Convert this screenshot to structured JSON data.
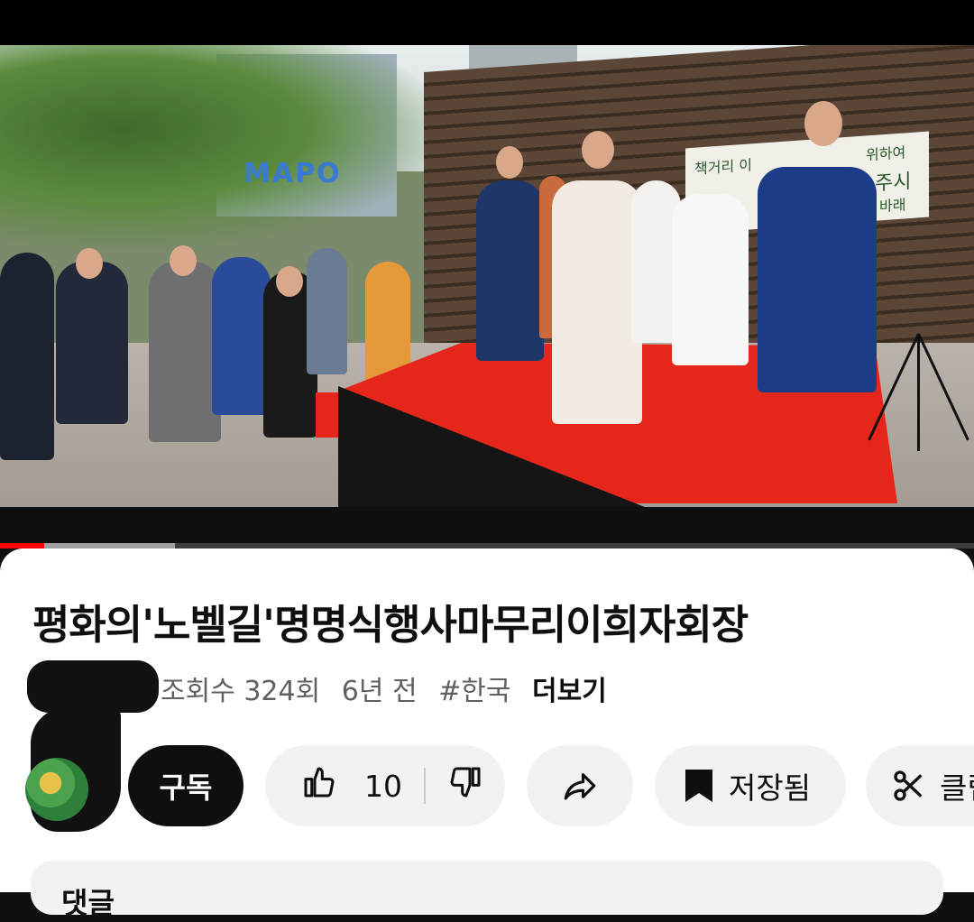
{
  "video": {
    "progress_fraction": 0.045,
    "buffered_fraction": 0.18,
    "scene": {
      "sign_text": "MAPO",
      "banner_lines": [
        "책거리 이",
        "위하여",
        "주시",
        "바래"
      ]
    }
  },
  "info": {
    "title": "평화의'노벨길'명명식행사마무리이희자회장",
    "views": "조회수 324회",
    "age": "6년 전",
    "hashtag": "#한국",
    "more_label": "더보기"
  },
  "actions": {
    "subscribe_label": "구독",
    "like_count": "10",
    "save_label": "저장됨",
    "clip_label": "클립"
  },
  "comments": {
    "header": "댓글"
  },
  "colors": {
    "progress_played": "#ff0000",
    "subscribe_bg": "#0f0f0f",
    "pill_bg": "#f2f2f2",
    "stage_red": "#e6261a"
  }
}
